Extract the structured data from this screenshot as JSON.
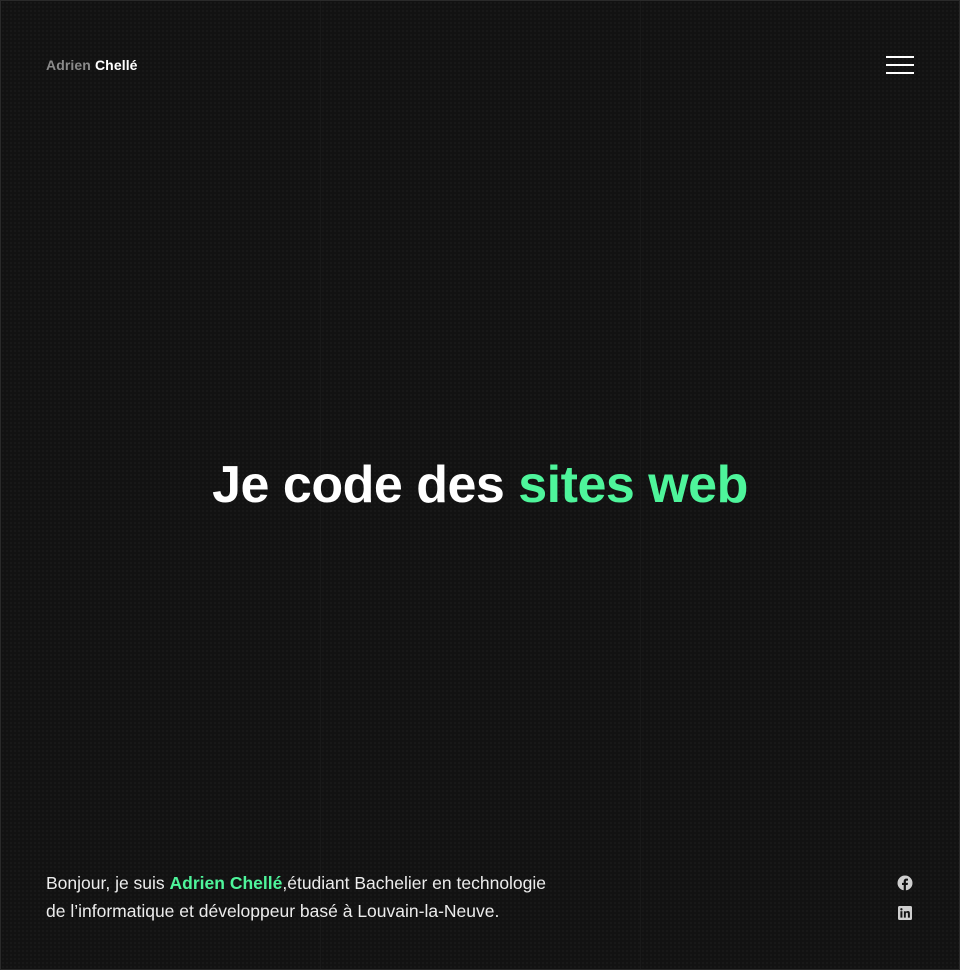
{
  "header": {
    "logo_first": "Adrien",
    "logo_last": "Chellé",
    "menu_icon": "hamburger-menu-icon"
  },
  "hero": {
    "title_plain": "Je code des ",
    "title_accent": "sites web"
  },
  "intro": {
    "lead": "Bonjour, je suis ",
    "name": "Adrien Chellé",
    "rest_line1": ",étudiant Bachelier en technologie",
    "rest_line2": "de l’informatique et développeur basé à Louvain-la-Neuve."
  },
  "social": {
    "items": [
      {
        "icon": "facebook-icon"
      },
      {
        "icon": "linkedin-icon"
      }
    ]
  },
  "colors": {
    "background": "#121212",
    "accent": "#4ef59b",
    "text": "#ffffff",
    "muted": "#8a8a8a"
  }
}
